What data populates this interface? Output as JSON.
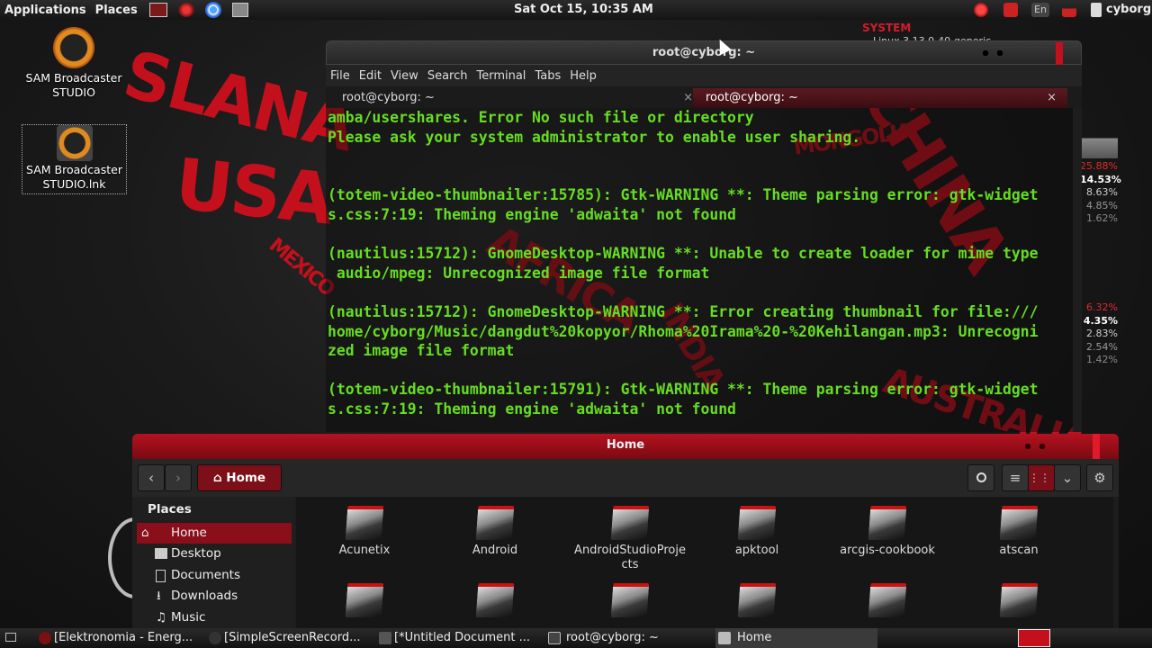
{
  "top_panel": {
    "applications": "Applications",
    "places": "Places",
    "clock": "Sat Oct 15, 10:35 AM",
    "user": "cyborg",
    "lang": "En"
  },
  "wallpaper": {
    "words": [
      "SLANA",
      "USA",
      "CHINA",
      "AUSTRALIA",
      "MONGOLIA",
      "AFRICA",
      "MEXICO",
      "INDIA"
    ]
  },
  "desktop_icons": [
    {
      "label": "SAM Broadcaster STUDIO"
    },
    {
      "label": "SAM Broadcaster STUDIO.lnk"
    }
  ],
  "terminal": {
    "title": "root@cyborg: ~",
    "menu": [
      "File",
      "Edit",
      "View",
      "Search",
      "Terminal",
      "Tabs",
      "Help"
    ],
    "tabs": [
      "root@cyborg: ~",
      "root@cyborg: ~"
    ],
    "output": "amba/usershares. Error No such file or directory\nPlease ask your system administrator to enable user sharing.\n\n\n(totem-video-thumbnailer:15785): Gtk-WARNING **: Theme parsing error: gtk-widget\ns.css:7:19: Theming engine 'adwaita' not found\n\n(nautilus:15712): GnomeDesktop-WARNING **: Unable to create loader for mime type\n audio/mpeg: Unrecognized image file format\n\n(nautilus:15712): GnomeDesktop-WARNING **: Error creating thumbnail for file:///\nhome/cyborg/Music/dangdut%20kopyor/Rhoma%20Irama%20-%20Kehilangan.mp3: Unrecogni\nzed image file format\n\n(totem-video-thumbnailer:15791): Gtk-WARNING **: Theme parsing error: gtk-widget\ns.css:7:19: Theming engine 'adwaita' not found"
  },
  "conky": {
    "title": "SYSTEM",
    "subtitle": "Linux 3.13.0-40-generic",
    "cpu": [
      "25.88%",
      "14.53%",
      "8.63%",
      "4.85%",
      "1.62%"
    ],
    "mem": [
      "6.32%",
      "4.35%",
      "2.83%",
      "2.54%",
      "1.42%"
    ]
  },
  "file_manager": {
    "title": "Home",
    "location": "Home",
    "sidebar_heading": "Places",
    "sidebar": [
      "Home",
      "Desktop",
      "Documents",
      "Downloads",
      "Music"
    ],
    "folders": [
      "Acunetix",
      "Android",
      "AndroidStudioProjects",
      "apktool",
      "arcgis-cookbook",
      "atscan"
    ]
  },
  "taskbar": [
    "[Elektronomia - Energ...",
    "[SimpleScreenRecord...",
    "[*Untitled Document ...",
    "root@cyborg: ~",
    "Home"
  ],
  "colors": {
    "accent": "#c4101c",
    "terminal_text": "#66dd22"
  }
}
